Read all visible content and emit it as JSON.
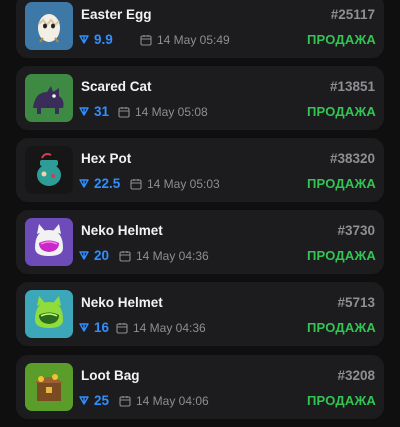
{
  "accent": {
    "price": "#2f8fff",
    "status": "#31c553",
    "muted": "#8e8e93",
    "card": "#1c1c1e"
  },
  "currency_icon": "ton-diamond-icon",
  "date_icon": "calendar-icon",
  "items": [
    {
      "name": "Easter Egg",
      "number": "#25117",
      "price": "9.9",
      "date": "14 May 05:49",
      "status": "ПРОДАЖА",
      "thumb_icon": "easter-egg-icon"
    },
    {
      "name": "Scared Cat",
      "number": "#13851",
      "price": "31",
      "date": "14 May 05:08",
      "status": "ПРОДАЖА",
      "thumb_icon": "scared-cat-icon"
    },
    {
      "name": "Hex Pot",
      "number": "#38320",
      "price": "22.5",
      "date": "14 May 05:03",
      "status": "ПРОДАЖА",
      "thumb_icon": "hex-pot-icon"
    },
    {
      "name": "Neko Helmet",
      "number": "#3730",
      "price": "20",
      "date": "14 May 04:36",
      "status": "ПРОДАЖА",
      "thumb_icon": "neko-helmet-icon"
    },
    {
      "name": "Neko Helmet",
      "number": "#5713",
      "price": "16",
      "date": "14 May 04:36",
      "status": "ПРОДАЖА",
      "thumb_icon": "neko-helmet-icon"
    },
    {
      "name": "Loot Bag",
      "number": "#3208",
      "price": "25",
      "date": "14 May 04:06",
      "status": "ПРОДАЖА",
      "thumb_icon": "loot-bag-icon"
    }
  ]
}
